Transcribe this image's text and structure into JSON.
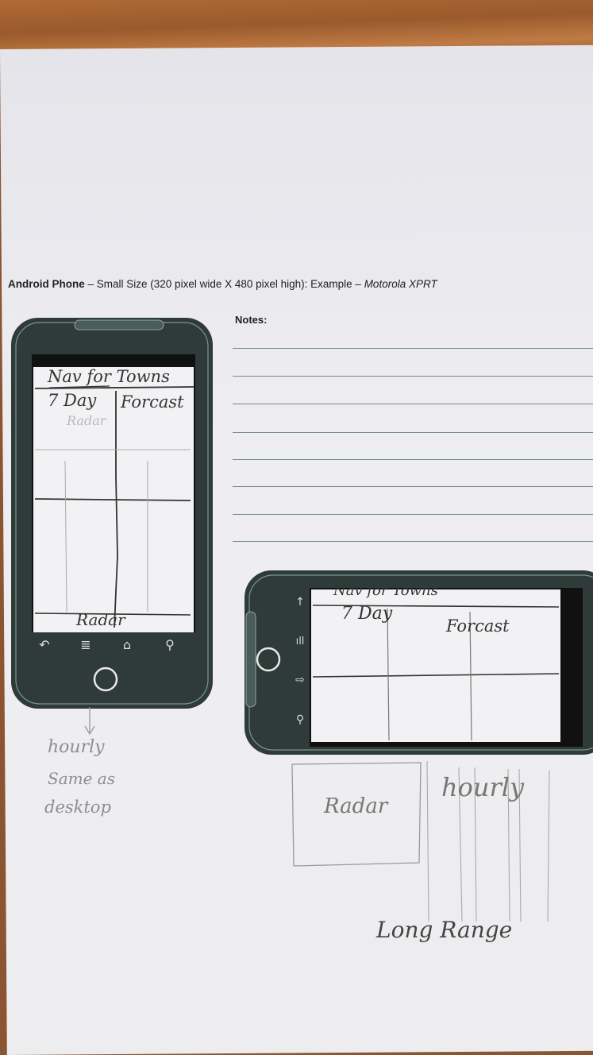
{
  "heading": {
    "device": "Android Phone",
    "dash1": " – ",
    "size": "Small Size (320 pixel wide X 480 pixel high): Example – ",
    "example": "Motorola XPRT"
  },
  "notes_label": "Notes:",
  "portrait": {
    "nav": "Nav for Towns",
    "seven_day": "7 Day",
    "forecast": "Forcast",
    "faded_radar": "Radar",
    "radar": "Radar",
    "nav_icons": [
      "back-icon",
      "menu-icon",
      "home-icon",
      "search-icon"
    ]
  },
  "below_portrait": {
    "hourly": "hourly",
    "same_as": "Same as",
    "desktop": "desktop"
  },
  "landscape": {
    "nav": "Nav for Towns",
    "seven_day": "7 Day",
    "forecast": "Forcast",
    "side_icons": [
      "up-arrow-icon",
      "signal-icon",
      "forward-icon",
      "search-icon"
    ]
  },
  "below_landscape": {
    "radar": "Radar",
    "hourly": "hourly",
    "long_range": "Long Range"
  }
}
